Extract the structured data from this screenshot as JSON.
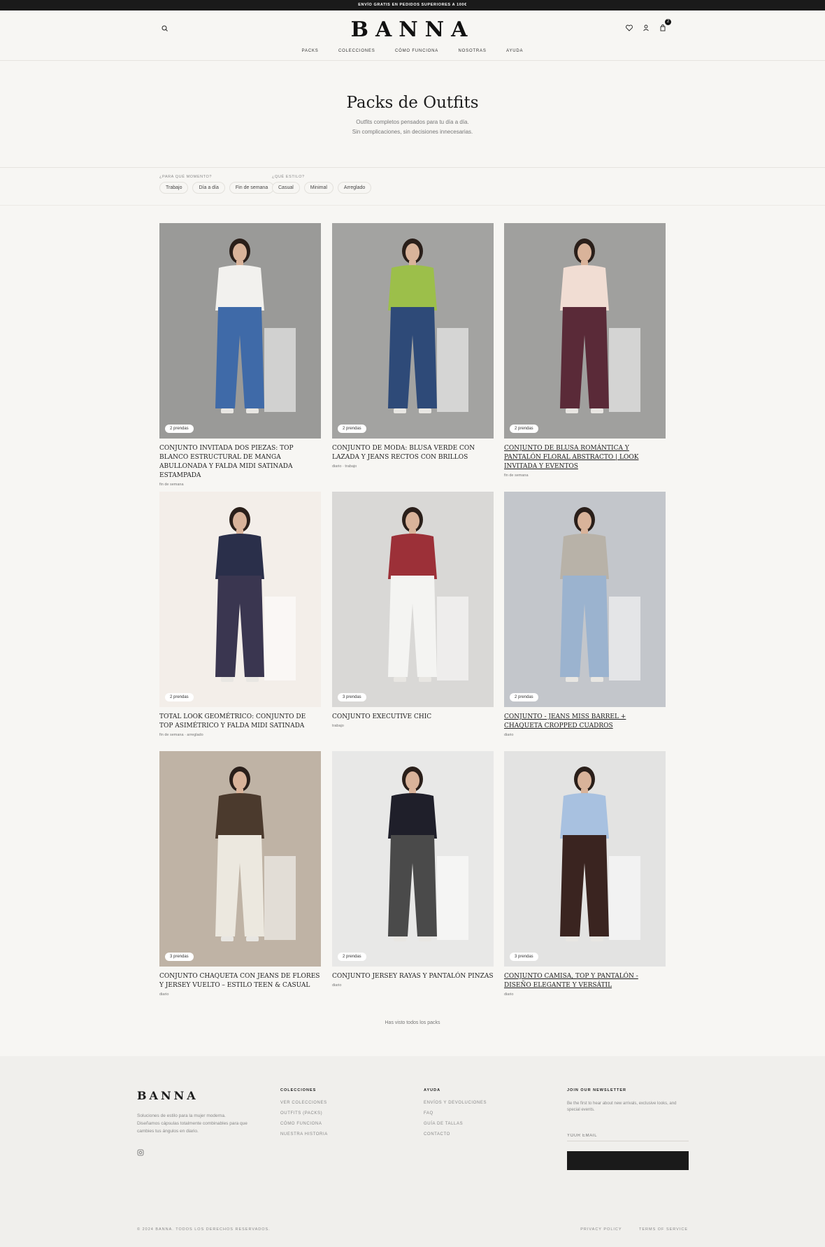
{
  "announcement": "ENVÍO GRATIS EN PEDIDOS SUPERIORES A 100€",
  "brand": "BANNA",
  "header": {
    "cart_count": "2",
    "nav": [
      "PACKS",
      "COLECCIONES",
      "CÓMO FUNCIONA",
      "NOSOTRAS",
      "AYUDA"
    ]
  },
  "hero": {
    "title": "Packs de Outfits",
    "line1": "Outfits completos pensados para tu día a día.",
    "line2": "Sin complicaciones, sin decisiones innecesarias."
  },
  "filters": {
    "group1": {
      "label": "¿PARA QUÉ MOMENTO?",
      "chips": [
        "Trabajo",
        "Día a día",
        "Fin de semana"
      ]
    },
    "group2": {
      "label": "¿QUÉ ESTILO?",
      "chips": [
        "Casual",
        "Minimal",
        "Arreglado"
      ]
    }
  },
  "products": [
    {
      "badge": "2 prendas",
      "title": "Conjunto invitada dos piezas: top blanco estructural de manga abullonada y falda midi satinada estampada",
      "tags": "fin de semana",
      "bg": "#9a9a98",
      "top": "#f2f1ee",
      "bottom": "#3f6aa8",
      "underline": false
    },
    {
      "badge": "2 prendas",
      "title": "Conjunto de moda: Blusa verde con lazada y jeans rectos con brillos",
      "tags": "diario · trabajo",
      "bg": "#a3a3a1",
      "top": "#9cbf4a",
      "bottom": "#2e4a78",
      "underline": false
    },
    {
      "badge": "2 prendas",
      "title": "Conjunto de Blusa Romántica y Pantalón Floral Abstracto | Look Invitada y Eventos",
      "tags": "fin de semana",
      "bg": "#a0a09e",
      "top": "#f1ddd3",
      "bottom": "#5a2a38",
      "underline": true
    },
    {
      "badge": "2 prendas",
      "title": "Total look geométrico: Conjunto de top asimétrico y falda midi satinada",
      "tags": "fin de semana · arreglado",
      "bg": "#f3eee9",
      "top": "#2a2f4a",
      "bottom": "#3a3650",
      "underline": false
    },
    {
      "badge": "3 prendas",
      "title": "Conjunto Executive Chic",
      "tags": "trabajo",
      "bg": "#d9d8d6",
      "top": "#9c3038",
      "bottom": "#f4f4f2",
      "underline": false
    },
    {
      "badge": "2 prendas",
      "title": "Conjunto - Jeans Miss Barrel + Chaqueta Cropped Cuadros",
      "tags": "diario",
      "bg": "#c3c6cb",
      "top": "#b8b2a8",
      "bottom": "#9bb3cf",
      "underline": true
    },
    {
      "badge": "3 prendas",
      "title": "Conjunto chaqueta con jeans de flores y jersey vuelto – Estilo teen & casual",
      "tags": "diario",
      "bg": "#bfb3a5",
      "top": "#4b3a2d",
      "bottom": "#ece8df",
      "underline": false
    },
    {
      "badge": "2 prendas",
      "title": "Conjunto jersey rayas y pantalón pinzas",
      "tags": "diario",
      "bg": "#e8e8e7",
      "top": "#1f1f2a",
      "bottom": "#4a4a4a",
      "underline": false
    },
    {
      "badge": "3 prendas",
      "title": "Conjunto camisa, top y pantalón - diseño elegante y versátil",
      "tags": "diario",
      "bg": "#e3e3e2",
      "top": "#a8c1e0",
      "bottom": "#3a2420",
      "underline": true
    }
  ],
  "more_text": "Has visto todos los packs",
  "footer": {
    "desc": "Soluciones de estilo para la mujer moderna. Diseñamos cápsulas totalmente combinables para que cambies tus ángulos en diario.",
    "col1": {
      "title": "COLECCIONES",
      "links": [
        "VER COLECCIONES",
        "OUTFITS (PACKS)",
        "CÓMO FUNCIONA",
        "NUESTRA HISTORIA"
      ]
    },
    "col2": {
      "title": "AYUDA",
      "links": [
        "ENVÍOS Y DEVOLUCIONES",
        "FAQ",
        "GUÍA DE TALLAS",
        "CONTACTO"
      ]
    },
    "newsletter": {
      "title": "JOIN OUR NEWSLETTER",
      "desc": "Be the first to hear about new arrivals, exclusive looks, and special events.",
      "placeholder": "YOUR EMAIL"
    },
    "copyright": "© 2024 BANNA. TODOS LOS DERECHOS RESERVADOS.",
    "privacy": "PRIVACY POLICY",
    "terms": "TERMS OF SERVICE"
  }
}
